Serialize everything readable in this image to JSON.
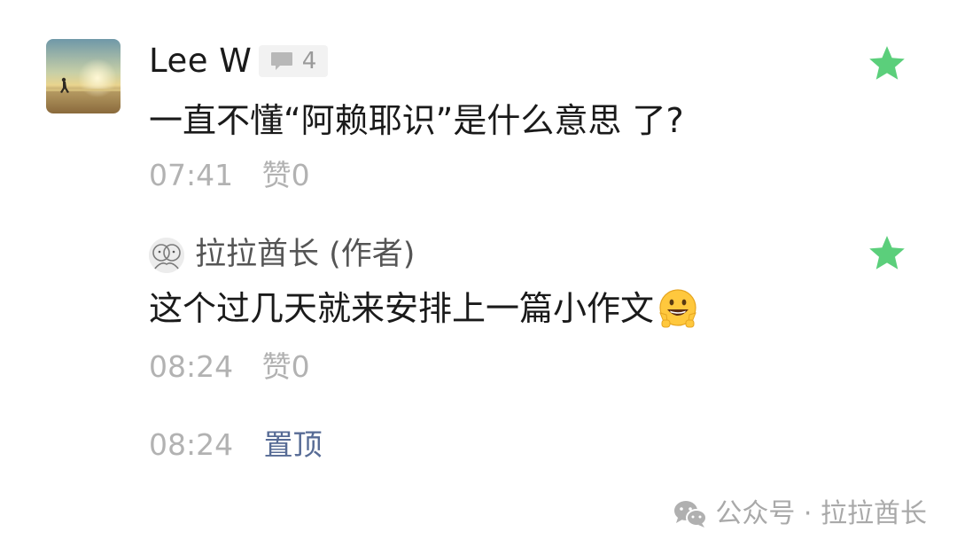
{
  "comment": {
    "username": "Lee W",
    "reply_count": "4",
    "text": "一直不懂“阿赖耶识”是什么意思 了?",
    "time": "07:41",
    "like_label": "赞",
    "like_count": "0",
    "star_color": "#5bcf7b"
  },
  "reply": {
    "author_name": "拉拉酋长 (作者)",
    "text": "这个过几天就来安排上一篇小作文",
    "emoji": "grinning-face-emoji",
    "time": "08:24",
    "like_label": "赞",
    "like_count": "0"
  },
  "pinned": {
    "time": "08:24",
    "action_label": "置顶",
    "action_color": "#576b95"
  },
  "watermark": {
    "text": "公众号 · 拉拉酋长",
    "icon": "wechat-icon"
  }
}
